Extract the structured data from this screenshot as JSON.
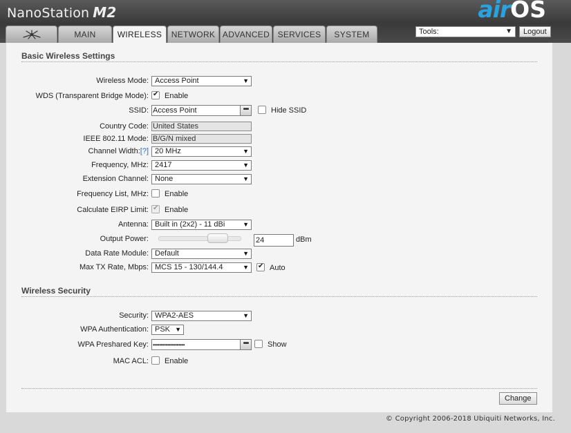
{
  "header": {
    "brand": "NanoStation",
    "model": "M2",
    "logo_air": "air",
    "logo_os": "OS"
  },
  "tabs": [
    {
      "label": "",
      "icon": "ubiquiti-logo-icon"
    },
    {
      "label": "MAIN"
    },
    {
      "label": "WIRELESS",
      "active": true
    },
    {
      "label": "NETWORK"
    },
    {
      "label": "ADVANCED"
    },
    {
      "label": "SERVICES"
    },
    {
      "label": "SYSTEM"
    }
  ],
  "tools": {
    "label": "Tools:",
    "logout": "Logout"
  },
  "basic": {
    "title": "Basic Wireless Settings",
    "wireless_mode": {
      "label": "Wireless Mode:",
      "value": "Access Point"
    },
    "wds": {
      "label": "WDS (Transparent Bridge Mode):",
      "option": "Enable",
      "checked": true
    },
    "ssid": {
      "label": "SSID:",
      "value": "Access Point",
      "hide_label": "Hide SSID",
      "hide_checked": false
    },
    "country": {
      "label": "Country Code:",
      "value": "United States"
    },
    "ieee": {
      "label": "IEEE 802.11 Mode:",
      "value": "B/G/N mixed"
    },
    "channel_width": {
      "label": "Channel Width:",
      "help": "[?]",
      "value": "20 MHz"
    },
    "frequency": {
      "label": "Frequency, MHz:",
      "value": "2417"
    },
    "extension": {
      "label": "Extension Channel:",
      "value": "None"
    },
    "freq_list": {
      "label": "Frequency List, MHz:",
      "option": "Enable",
      "checked": false
    },
    "eirp": {
      "label": "Calculate EIRP Limit:",
      "option": "Enable",
      "checked": true
    },
    "antenna": {
      "label": "Antenna:",
      "value": "Built in (2x2) - 11 dBi"
    },
    "power": {
      "label": "Output Power:",
      "value": "24",
      "unit": "dBm",
      "level": 0.78
    },
    "data_rate": {
      "label": "Data Rate Module:",
      "value": "Default"
    },
    "max_tx": {
      "label": "Max TX Rate, Mbps:",
      "value": "MCS 15 - 130/144.4",
      "auto_label": "Auto",
      "auto_checked": true
    }
  },
  "security": {
    "title": "Wireless Security",
    "security": {
      "label": "Security:",
      "value": "WPA2-AES"
    },
    "auth": {
      "label": "WPA Authentication:",
      "value": "PSK"
    },
    "psk": {
      "label": "WPA Preshared Key:",
      "value": "••••••••••••••••••••",
      "show_label": "Show",
      "show_checked": false
    },
    "mac_acl": {
      "label": "MAC ACL:",
      "option": "Enable",
      "checked": false
    }
  },
  "change": "Change",
  "footer": "© Copyright 2006-2018 Ubiquiti Networks, Inc."
}
